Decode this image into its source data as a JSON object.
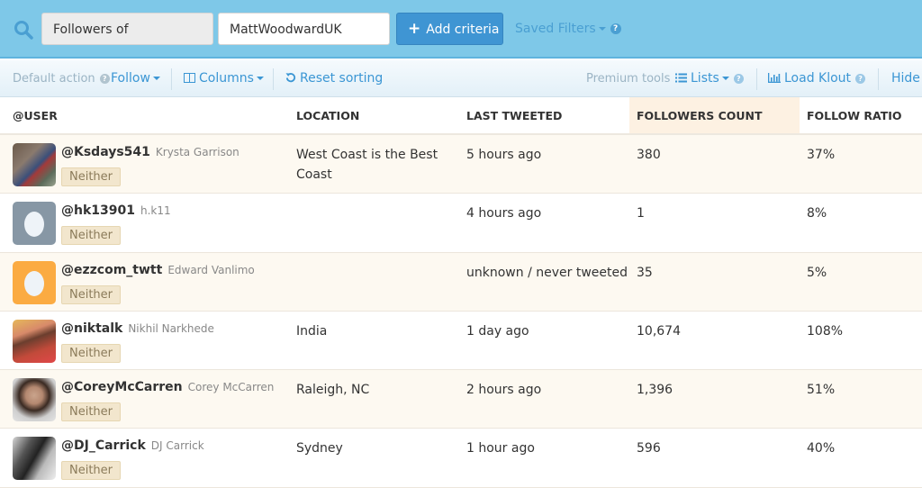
{
  "search": {
    "criteria_type": "Followers of",
    "criteria_value": "MattWoodwardUK",
    "add_criteria_label": "Add criteria",
    "saved_filters_label": "Saved Filters"
  },
  "toolbar": {
    "default_action_label": "Default action",
    "default_action_value": "Follow",
    "columns_label": "Columns",
    "reset_sorting_label": "Reset sorting",
    "premium_tools_label": "Premium tools",
    "lists_label": "Lists",
    "load_klout_label": "Load Klout",
    "hide_label": "Hide"
  },
  "table": {
    "columns": [
      "@USER",
      "LOCATION",
      "LAST TWEETED",
      "FOLLOWERS COUNT",
      "FOLLOW RATIO"
    ],
    "sorted_column": "FOLLOWERS COUNT",
    "rows": [
      {
        "handle": "@Ksdays541",
        "name": "Krysta Garrison",
        "relationship": "Neither",
        "location": "West Coast is the Best Coast",
        "last_tweeted": "5 hours ago",
        "followers": "380",
        "ratio": "37%",
        "avatar": "photo"
      },
      {
        "handle": "@hk13901",
        "name": "h.k11",
        "relationship": "Neither",
        "location": "",
        "last_tweeted": "4 hours ago",
        "followers": "1",
        "ratio": "8%",
        "avatar": "egg-gray"
      },
      {
        "handle": "@ezzcom_twtt",
        "name": "Edward Vanlimo",
        "relationship": "Neither",
        "location": "",
        "last_tweeted": "unknown / never tweeted",
        "followers": "35",
        "ratio": "5%",
        "avatar": "egg-orange"
      },
      {
        "handle": "@niktalk",
        "name": "Nikhil Narkhede",
        "relationship": "Neither",
        "location": "India",
        "last_tweeted": "1 day ago",
        "followers": "10,674",
        "ratio": "108%",
        "avatar": "photo"
      },
      {
        "handle": "@CoreyMcCarren",
        "name": "Corey McCarren",
        "relationship": "Neither",
        "location": "Raleigh, NC",
        "last_tweeted": "2 hours ago",
        "followers": "1,396",
        "ratio": "51%",
        "avatar": "photo"
      },
      {
        "handle": "@DJ_Carrick",
        "name": "DJ Carrick",
        "relationship": "Neither",
        "location": "Sydney",
        "last_tweeted": "1 hour ago",
        "followers": "596",
        "ratio": "40%",
        "avatar": "photo"
      }
    ]
  },
  "colors": {
    "topbar": "#7ec8e8",
    "accent": "#3f95d3",
    "link": "#3b96d4",
    "row_alt": "#fdf9f1",
    "badge": "#f2e6cd"
  }
}
